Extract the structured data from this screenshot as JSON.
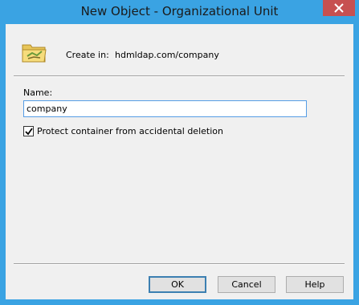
{
  "window": {
    "title": "New Object - Organizational Unit"
  },
  "header": {
    "icon": "ou-folder-icon",
    "create_in_label": "Create in:",
    "create_in_value": "hdmldap.com/company"
  },
  "form": {
    "name_label": "Name:",
    "name_value": "company",
    "protect_checkbox_label": "Protect container from accidental deletion",
    "protect_checked": true
  },
  "buttons": {
    "ok": "OK",
    "cancel": "Cancel",
    "help": "Help"
  },
  "colors": {
    "titlebar": "#3aa3e3",
    "close_button": "#c75050",
    "dialog_background": "#f0f0f0"
  }
}
